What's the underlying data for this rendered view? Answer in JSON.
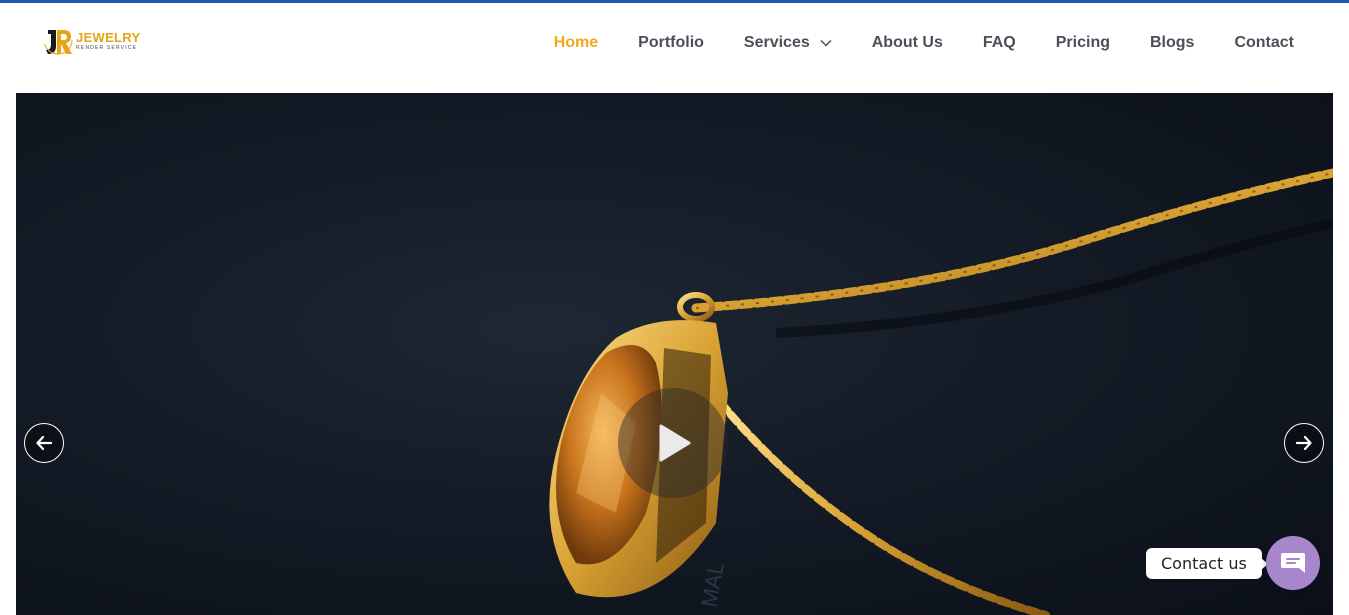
{
  "brand": {
    "name": "JEWELRY",
    "tagline": "RENDER SERVICE",
    "monogram": "JR",
    "accent_color": "#f2a81d"
  },
  "nav": {
    "items": [
      {
        "label": "Home",
        "active": true
      },
      {
        "label": "Portfolio"
      },
      {
        "label": "Services",
        "has_dropdown": true
      },
      {
        "label": "About Us"
      },
      {
        "label": "FAQ"
      },
      {
        "label": "Pricing"
      },
      {
        "label": "Blogs"
      },
      {
        "label": "Contact"
      }
    ]
  },
  "hero": {
    "prev_icon": "arrow-left-icon",
    "next_icon": "arrow-right-icon",
    "play_icon": "play-icon"
  },
  "contact_widget": {
    "label": "Contact us",
    "icon": "chat-bubble-icon",
    "color": "#a886cd"
  }
}
